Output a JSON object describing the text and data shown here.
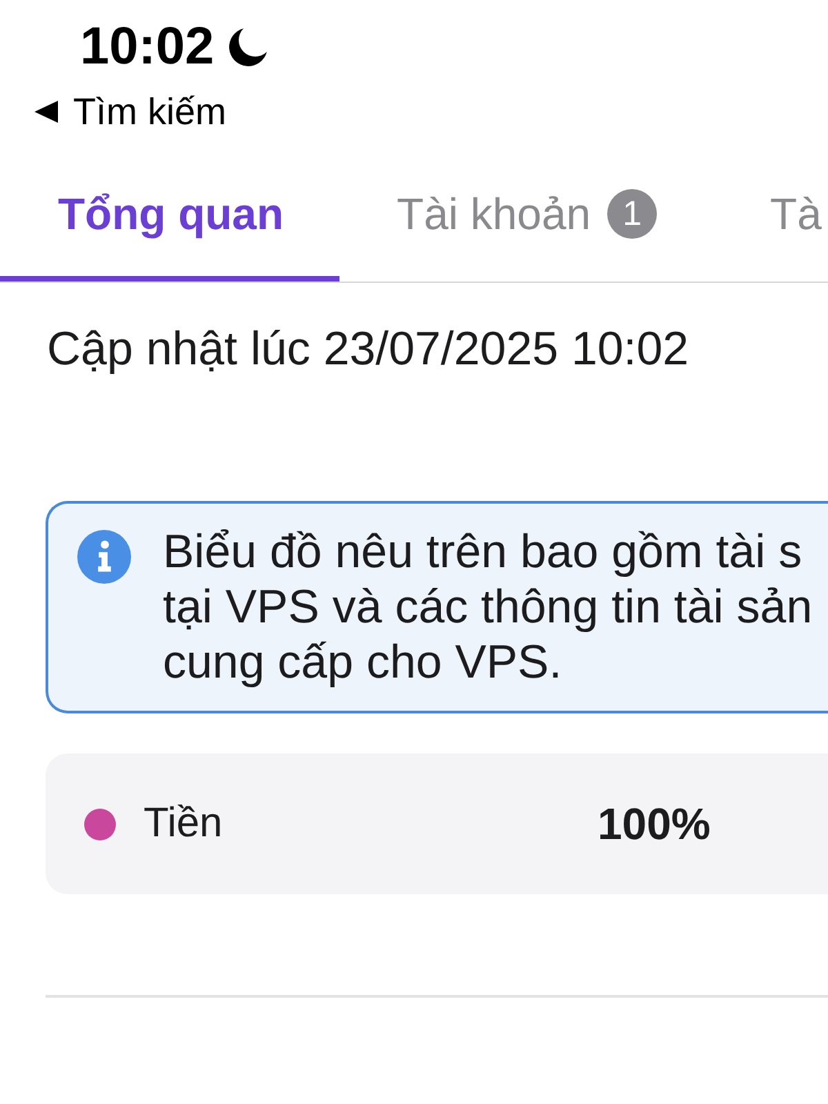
{
  "status_bar": {
    "time": "10:02"
  },
  "back_link": {
    "label": "Tìm kiếm"
  },
  "tabs": [
    {
      "label": "Tổng quan",
      "selected": true
    },
    {
      "label": "Tài khoản",
      "badge": "1",
      "selected": false
    },
    {
      "label": "Tà",
      "selected": false
    }
  ],
  "updated_at": "Cập nhật lúc 23/07/2025 10:02",
  "info_box": {
    "lines": [
      "Biểu đồ nêu trên bao gồm tài s",
      "tại VPS và các thông tin tài sản",
      "cung cấp cho VPS."
    ]
  },
  "allocation": [
    {
      "name": "Tiền",
      "color": "#c9489d",
      "share": "100%"
    }
  ]
}
